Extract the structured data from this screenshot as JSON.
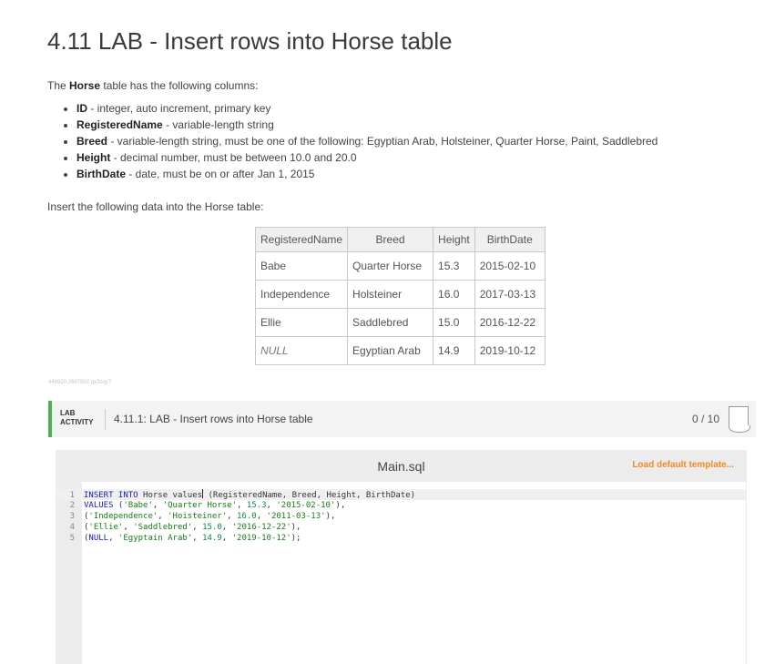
{
  "page": {
    "title": "4.11 LAB - Insert rows into Horse table",
    "intro_prefix": "The ",
    "intro_bold": "Horse",
    "intro_suffix": " table has the following columns:",
    "columns": [
      {
        "name": "ID",
        "desc": " - integer, auto increment, primary key"
      },
      {
        "name": "RegisteredName",
        "desc": " - variable-length string"
      },
      {
        "name": "Breed",
        "desc": " - variable-length string, must be one of the following: Egyptian Arab, Holsteiner, Quarter Horse, Paint, Saddlebred"
      },
      {
        "name": "Height",
        "desc": " - decimal number, must be between 10.0 and 20.0"
      },
      {
        "name": "BirthDate",
        "desc": " - date, must be on or after Jan 1, 2015"
      }
    ],
    "insert_text": "Insert the following data into the Horse table:",
    "id_code": "446920.2697992.qx3zqy7"
  },
  "table": {
    "headers": [
      "RegisteredName",
      "Breed",
      "Height",
      "BirthDate"
    ],
    "rows": [
      [
        "Babe",
        "Quarter Horse",
        "15.3",
        "2015-02-10"
      ],
      [
        "Independence",
        "Holsteiner",
        "16.0",
        "2017-03-13"
      ],
      [
        "Ellie",
        "Saddlebred",
        "15.0",
        "2016-12-22"
      ],
      [
        "NULL",
        "Egyptian Arab",
        "14.9",
        "2019-10-12"
      ]
    ]
  },
  "lab": {
    "tag_line1": "LAB",
    "tag_line2": "ACTIVITY",
    "title": "4.11.1: LAB - Insert rows into Horse table",
    "score": "0 / 10",
    "accent_color": "#4caf50"
  },
  "editor": {
    "filename": "Main.sql",
    "load_template": "Load default template...",
    "load_color": "#f08a24",
    "lines": [
      {
        "n": "1",
        "parts": [
          [
            "kw",
            "INSERT INTO"
          ],
          [
            "t",
            " Horse values"
          ],
          [
            "cursor",
            ""
          ],
          [
            "t",
            " (RegisteredName, Breed, Height, BirthDate)"
          ]
        ]
      },
      {
        "n": "2",
        "parts": [
          [
            "kw",
            "VALUES"
          ],
          [
            "t",
            " ("
          ],
          [
            "str",
            "'Babe'"
          ],
          [
            "t",
            ", "
          ],
          [
            "str",
            "'Quarter Horse'"
          ],
          [
            "t",
            ", "
          ],
          [
            "num",
            "15.3"
          ],
          [
            "t",
            ", "
          ],
          [
            "str",
            "'2015-02-10'"
          ],
          [
            "t",
            "),"
          ]
        ]
      },
      {
        "n": "3",
        "parts": [
          [
            "t",
            "("
          ],
          [
            "str",
            "'Independence'"
          ],
          [
            "t",
            ", "
          ],
          [
            "str",
            "'Hoisteiner'"
          ],
          [
            "t",
            ", "
          ],
          [
            "num",
            "16.0"
          ],
          [
            "t",
            ", "
          ],
          [
            "str",
            "'2011-03-13'"
          ],
          [
            "t",
            "),"
          ]
        ]
      },
      {
        "n": "4",
        "parts": [
          [
            "t",
            "("
          ],
          [
            "str",
            "'Ellie'"
          ],
          [
            "t",
            ", "
          ],
          [
            "str",
            "'Saddlebred'"
          ],
          [
            "t",
            ", "
          ],
          [
            "num",
            "15.0"
          ],
          [
            "t",
            ", "
          ],
          [
            "str",
            "'2016-12-22'"
          ],
          [
            "t",
            "),"
          ]
        ]
      },
      {
        "n": "5",
        "parts": [
          [
            "t",
            "("
          ],
          [
            "kw",
            "NULL"
          ],
          [
            "t",
            ", "
          ],
          [
            "str",
            "'Egyptain Arab'"
          ],
          [
            "t",
            ", "
          ],
          [
            "num",
            "14.9"
          ],
          [
            "t",
            ", "
          ],
          [
            "str",
            "'2019-10-12'"
          ],
          [
            "t",
            ");"
          ]
        ]
      }
    ]
  }
}
